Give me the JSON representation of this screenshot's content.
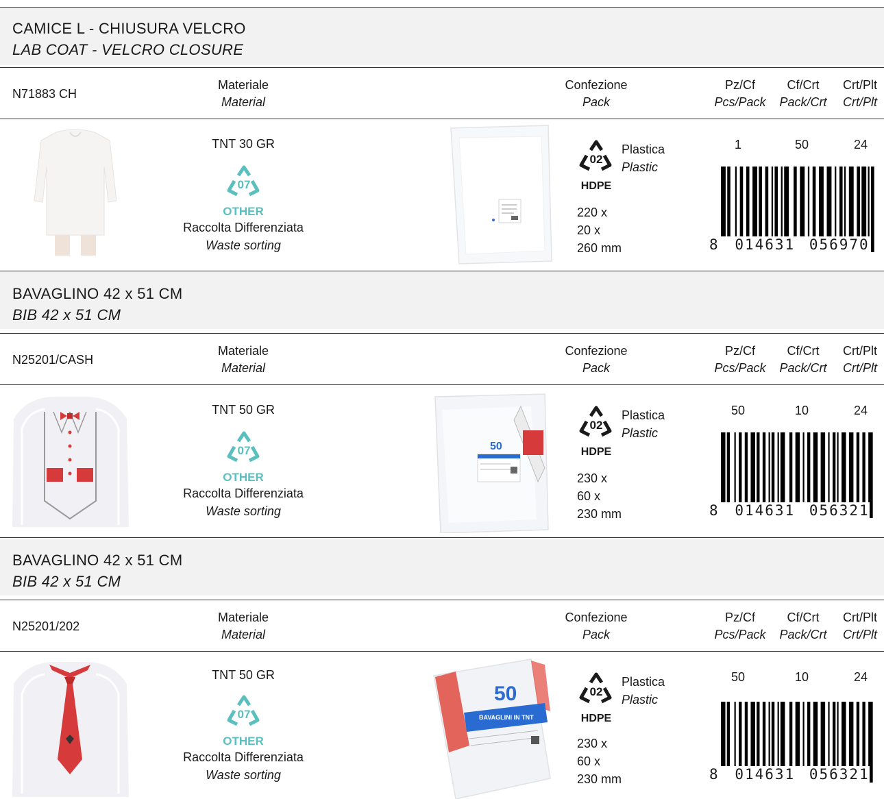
{
  "products": [
    {
      "title_it": "CAMICE L - CHIUSURA VELCRO",
      "title_en": "LAB COAT - VELCRO CLOSURE",
      "code": "N71883 CH",
      "material": "TNT 30 GR",
      "pack_dims": [
        "220 x",
        "20 x",
        "260 mm"
      ],
      "pz_cf": "1",
      "cf_crt": "50",
      "crt_plt": "24",
      "barcode_first": "8",
      "barcode_left": "014631",
      "barcode_right": "056970",
      "product_image": "lab-coat-image",
      "pack_image": "bag-pack-image"
    },
    {
      "title_it": "BAVAGLINO 42 x 51 CM",
      "title_en": "BIB 42 x 51 CM",
      "code": "N25201/CASH",
      "material": "TNT 50 GR",
      "pack_dims": [
        "230 x",
        "60 x",
        "230 mm"
      ],
      "pz_cf": "50",
      "cf_crt": "10",
      "crt_plt": "24",
      "barcode_first": "8",
      "barcode_left": "014631",
      "barcode_right": "056321",
      "product_image": "bib-waistcoat-image",
      "pack_image": "bib-pack-image",
      "pack_count": "50"
    },
    {
      "title_it": "BAVAGLINO 42 x 51 CM",
      "title_en": "BIB 42 x 51 CM",
      "code": "N25201/202",
      "material": "TNT 50 GR",
      "pack_dims": [
        "230 x",
        "60 x",
        "230 mm"
      ],
      "pz_cf": "50",
      "cf_crt": "10",
      "crt_plt": "24",
      "barcode_first": "8",
      "barcode_left": "014631",
      "barcode_right": "056321",
      "product_image": "bib-tie-image",
      "pack_image": "bib-pack-image",
      "pack_count": "50",
      "pack_text": "BAVAGLINI IN TNT"
    }
  ],
  "labels": {
    "materiale": "Materiale",
    "material": "Material",
    "confezione": "Confezione",
    "pack": "Pack",
    "pz_cf": "Pz/Cf",
    "pcs_pack": "Pcs/Pack",
    "cf_crt": "Cf/Crt",
    "pack_crt": "Pack/Crt",
    "crt_plt": "Crt/Plt",
    "crt_plt_en": "Crt/Plt",
    "recycle_other_num": "07",
    "other": "OTHER",
    "raccolta": "Raccolta Differenziata",
    "waste": "Waste sorting",
    "hdpe_num": "02",
    "hdpe": "HDPE",
    "plastica": "Plastica",
    "plastic": "Plastic"
  },
  "colors": {
    "recycle_teal": "#5bbfc0",
    "band": "#f2f2f2",
    "red_accent": "#d63a3a"
  }
}
